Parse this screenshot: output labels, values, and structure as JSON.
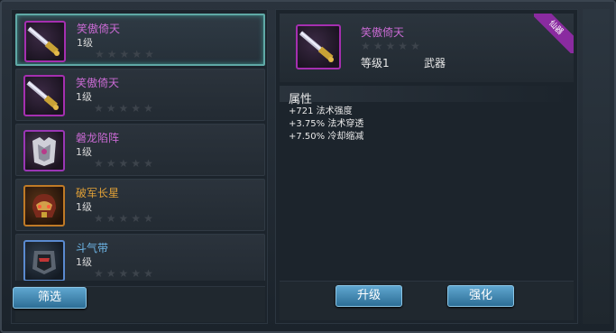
{
  "items": [
    {
      "name": "笑傲倚天",
      "level": "1级",
      "rarity": "purple"
    },
    {
      "name": "笑傲倚天",
      "level": "1级",
      "rarity": "purple"
    },
    {
      "name": "磐龙陷阵",
      "level": "1级",
      "rarity": "purple"
    },
    {
      "name": "破军长星",
      "level": "1级",
      "rarity": "orange"
    },
    {
      "name": "斗气带",
      "level": "1级",
      "rarity": "blue"
    }
  ],
  "filter_button": "筛选",
  "detail": {
    "name": "笑傲倚天",
    "level": "等级1",
    "type": "武器",
    "tag": "仙器",
    "attr_title": "属性",
    "attrs": [
      "+721 法术强度",
      "+3.75% 法术穿透",
      "+7.50% 冷却缩减"
    ]
  },
  "buttons": {
    "upgrade": "升级",
    "strengthen": "强化"
  },
  "colors": {
    "purple": "#c86ad2",
    "orange": "#e0a037",
    "blue": "#6eb7e8",
    "button": "#3d86b0"
  },
  "icons": {
    "sword": "sword-icon",
    "armor": "armor-icon",
    "helmet": "helmet-icon",
    "belt": "belt-icon",
    "star": "star-icon"
  }
}
